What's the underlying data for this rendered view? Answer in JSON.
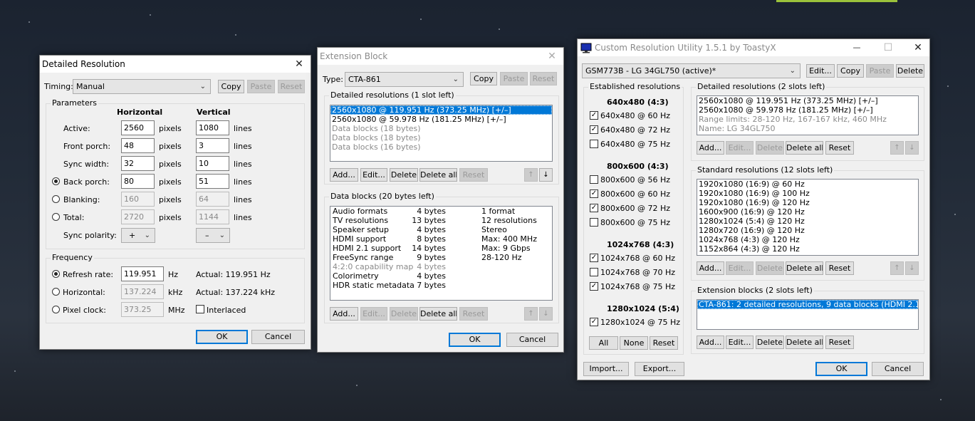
{
  "detailed": {
    "title": "Detailed Resolution",
    "close": "✕",
    "timing_label": "Timing:",
    "timing_value": "Manual",
    "copy": "Copy",
    "paste": "Paste",
    "reset": "Reset",
    "parameters": "Parameters",
    "horizontal": "Horizontal",
    "vertical": "Vertical",
    "rows": [
      {
        "label": "Active:",
        "h": "2560",
        "v": "1080"
      },
      {
        "label": "Front porch:",
        "h": "48",
        "v": "3"
      },
      {
        "label": "Sync width:",
        "h": "32",
        "v": "10"
      },
      {
        "label": "Back porch:",
        "h": "80",
        "v": "51"
      },
      {
        "label": "Blanking:",
        "h": "160",
        "v": "64"
      },
      {
        "label": "Total:",
        "h": "2720",
        "v": "1144"
      }
    ],
    "pixels": "pixels",
    "lines": "lines",
    "sync_polarity": "Sync polarity:",
    "h_polarity": "+",
    "v_polarity": "–",
    "frequency": "Frequency",
    "refresh_label": "Refresh rate:",
    "refresh_value": "119.951",
    "hz": "Hz",
    "refresh_actual": "Actual: 119.951 Hz",
    "horiz_label": "Horizontal:",
    "horiz_value": "137.224",
    "khz": "kHz",
    "horiz_actual": "Actual: 137.224 kHz",
    "pclock_label": "Pixel clock:",
    "pclock_value": "373.25",
    "mhz": "MHz",
    "interlaced": "Interlaced",
    "ok": "OK",
    "cancel": "Cancel"
  },
  "extension": {
    "title": "Extension Block",
    "close": "✕",
    "type_label": "Type:",
    "type_value": "CTA-861",
    "copy": "Copy",
    "paste": "Paste",
    "reset": "Reset",
    "detailed_title": "Detailed resolutions (1 slot left)",
    "detailed_items": [
      {
        "text": "2560x1080 @ 119.951 Hz (373.25 MHz) [+/–]",
        "state": "sel"
      },
      {
        "text": "2560x1080 @ 59.978 Hz (181.25 MHz) [+/–]",
        "state": ""
      },
      {
        "text": "Data blocks (18 bytes)",
        "state": "gray"
      },
      {
        "text": "Data blocks (18 bytes)",
        "state": "gray"
      },
      {
        "text": "Data blocks (16 bytes)",
        "state": "gray"
      }
    ],
    "add": "Add...",
    "edit": "Edit...",
    "delete": "Delete",
    "delete_all": "Delete all",
    "up": "↑",
    "down": "↓",
    "datablocks_title": "Data blocks (20 bytes left)",
    "datablocks": [
      {
        "name": "Audio formats",
        "bytes": "4 bytes",
        "info": "1 format",
        "gray": false
      },
      {
        "name": "TV resolutions",
        "bytes": "13 bytes",
        "info": "12 resolutions",
        "gray": false
      },
      {
        "name": "Speaker setup",
        "bytes": "4 bytes",
        "info": "Stereo",
        "gray": false
      },
      {
        "name": "HDMI support",
        "bytes": "8 bytes",
        "info": "Max: 400 MHz",
        "gray": false
      },
      {
        "name": "HDMI 2.1 support",
        "bytes": "14 bytes",
        "info": "Max: 9 Gbps",
        "gray": false
      },
      {
        "name": "FreeSync range",
        "bytes": "9 bytes",
        "info": "28-120 Hz",
        "gray": false
      },
      {
        "name": "4:2:0 capability map",
        "bytes": "4 bytes",
        "info": "",
        "gray": true
      },
      {
        "name": "Colorimetry",
        "bytes": "4 bytes",
        "info": "",
        "gray": false
      },
      {
        "name": "HDR static metadata",
        "bytes": "7 bytes",
        "info": "",
        "gray": false
      }
    ],
    "ok": "OK",
    "cancel": "Cancel"
  },
  "cru": {
    "title": "Custom Resolution Utility 1.5.1 by ToastyX",
    "minimize": "—",
    "maximize": "☐",
    "close": "✕",
    "monitor": "GSM773B - LG 34GL750 (active)*",
    "edit": "Edit...",
    "copy": "Copy",
    "paste": "Paste",
    "delete": "Delete",
    "established_title": "Established resolutions",
    "established_groups": [
      {
        "header": "640x480 (4:3)",
        "items": [
          {
            "label": "640x480 @ 60 Hz",
            "checked": true
          },
          {
            "label": "640x480 @ 72 Hz",
            "checked": true
          },
          {
            "label": "640x480 @ 75 Hz",
            "checked": false
          }
        ]
      },
      {
        "header": "800x600 (4:3)",
        "items": [
          {
            "label": "800x600 @ 56 Hz",
            "checked": false
          },
          {
            "label": "800x600 @ 60 Hz",
            "checked": true
          },
          {
            "label": "800x600 @ 72 Hz",
            "checked": true
          },
          {
            "label": "800x600 @ 75 Hz",
            "checked": false
          }
        ]
      },
      {
        "header": "1024x768 (4:3)",
        "items": [
          {
            "label": "1024x768 @ 60 Hz",
            "checked": true
          },
          {
            "label": "1024x768 @ 70 Hz",
            "checked": false
          },
          {
            "label": "1024x768 @ 75 Hz",
            "checked": true
          }
        ]
      },
      {
        "header": "1280x1024 (5:4)",
        "items": [
          {
            "label": "1280x1024 @ 75 Hz",
            "checked": true
          }
        ]
      }
    ],
    "all": "All",
    "none": "None",
    "reset": "Reset",
    "detailed_title": "Detailed resolutions (2 slots left)",
    "detailed_items": [
      {
        "text": "2560x1080 @ 119.951 Hz (373.25 MHz) [+/–]",
        "state": ""
      },
      {
        "text": "2560x1080 @ 59.978 Hz (181.25 MHz) [+/–]",
        "state": ""
      },
      {
        "text": "Range limits: 28-120 Hz, 167-167 kHz, 460 MHz",
        "state": "gray"
      },
      {
        "text": "Name: LG 34GL750",
        "state": "gray"
      }
    ],
    "add": "Add...",
    "edit_btn": "Edit...",
    "delete_btn": "Delete",
    "delete_all": "Delete all",
    "up": "↑",
    "down": "↓",
    "standard_title": "Standard resolutions (12 slots left)",
    "standard_items": [
      {
        "text": "1920x1080 (16:9) @ 60 Hz",
        "state": ""
      },
      {
        "text": "1920x1080 (16:9) @ 100 Hz",
        "state": ""
      },
      {
        "text": "1920x1080 (16:9) @ 120 Hz",
        "state": ""
      },
      {
        "text": "1600x900 (16:9) @ 120 Hz",
        "state": ""
      },
      {
        "text": "1280x1024 (5:4) @ 120 Hz",
        "state": ""
      },
      {
        "text": "1280x720 (16:9) @ 120 Hz",
        "state": ""
      },
      {
        "text": "1024x768 (4:3) @ 120 Hz",
        "state": ""
      },
      {
        "text": "1152x864 (4:3) @ 120 Hz",
        "state": ""
      }
    ],
    "extension_title": "Extension blocks (2 slots left)",
    "extension_items": [
      {
        "text": "CTA-861: 2 detailed resolutions, 9 data blocks (HDMI 2.1)",
        "state": "sel"
      }
    ],
    "import": "Import...",
    "export": "Export...",
    "ok": "OK",
    "cancel": "Cancel",
    "icon": "monitor-icon"
  }
}
